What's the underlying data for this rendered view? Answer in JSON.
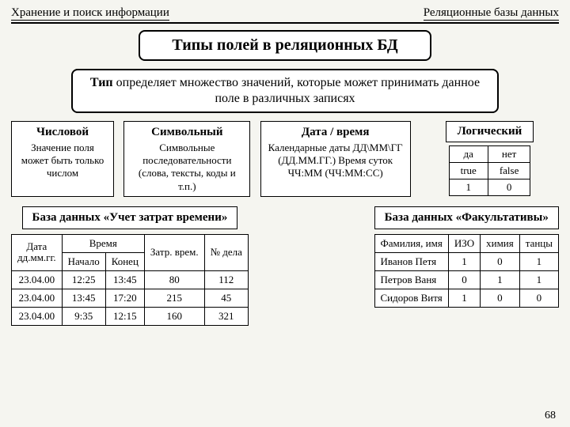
{
  "header": {
    "left": "Хранение и поиск информации",
    "right": "Реляционные базы данных"
  },
  "title": "Типы полей в реляционных БД",
  "definition": {
    "bold": "Тип",
    "rest": " определяет множество значений, которые может принимать данное поле в различных записях"
  },
  "types": {
    "numeric": {
      "title": "Числовой",
      "desc": "Значение поля может быть только числом"
    },
    "symbolic": {
      "title": "Символьный",
      "desc": "Символьные последовательности (слова, тексты, коды и т.п.)"
    },
    "datetime": {
      "title": "Дата / время",
      "desc": "Календарные даты ДД\\ММ\\ГГ (ДД.ММ.ГГ.) Время суток ЧЧ:ММ (ЧЧ:ММ:СС)"
    },
    "logical": {
      "title": "Логический",
      "rows": [
        [
          "да",
          "нет"
        ],
        [
          "true",
          "false"
        ],
        [
          "1",
          "0"
        ]
      ]
    }
  },
  "db_time": {
    "title": "База данных «Учет затрат времени»",
    "head": {
      "date": "Дата",
      "date_sub": "дд.мм.гг.",
      "time": "Время",
      "start": "Начало",
      "end": "Конец",
      "spent": "Затр. врем.",
      "task": "№ дела"
    },
    "rows": [
      [
        "23.04.00",
        "12:25",
        "13:45",
        "80",
        "112"
      ],
      [
        "23.04.00",
        "13:45",
        "17:20",
        "215",
        "45"
      ],
      [
        "23.04.00",
        "9:35",
        "12:15",
        "160",
        "321"
      ]
    ]
  },
  "db_fac": {
    "title": "База данных «Факультативы»",
    "head": [
      "Фамилия, имя",
      "ИЗО",
      "химия",
      "танцы"
    ],
    "rows": [
      [
        "Иванов Петя",
        "1",
        "0",
        "1"
      ],
      [
        "Петров Ваня",
        "0",
        "1",
        "1"
      ],
      [
        "Сидоров Витя",
        "1",
        "0",
        "0"
      ]
    ]
  },
  "page": "68"
}
